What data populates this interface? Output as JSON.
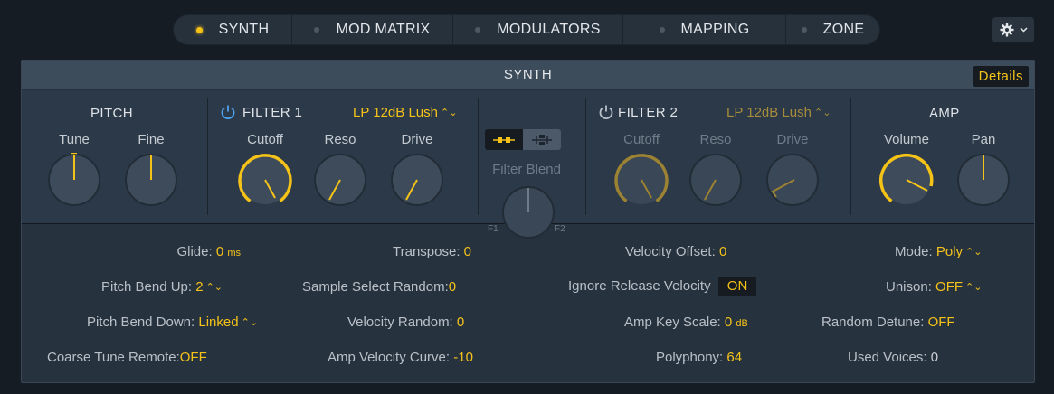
{
  "tabs": [
    {
      "label": "SYNTH",
      "active": true
    },
    {
      "label": "MOD MATRIX",
      "active": false
    },
    {
      "label": "MODULATORS",
      "active": false
    },
    {
      "label": "MAPPING",
      "active": false
    },
    {
      "label": "ZONE",
      "active": false
    }
  ],
  "gear_icon": "gear-icon",
  "accent_color": "#f5c318",
  "panel": {
    "title": "SYNTH",
    "details_label": "Details"
  },
  "pitch": {
    "title": "PITCH",
    "tune_label": "Tune",
    "fine_label": "Fine"
  },
  "filter1": {
    "title": "FILTER 1",
    "type": "LP 12dB Lush",
    "cutoff_label": "Cutoff",
    "reso_label": "Reso",
    "drive_label": "Drive",
    "enabled": true
  },
  "blend": {
    "label": "Filter Blend",
    "f1": "F1",
    "f2": "F2"
  },
  "filter2": {
    "title": "FILTER 2",
    "type": "LP 12dB Lush",
    "cutoff_label": "Cutoff",
    "reso_label": "Reso",
    "drive_label": "Drive",
    "enabled": false
  },
  "amp": {
    "title": "AMP",
    "volume_label": "Volume",
    "pan_label": "Pan"
  },
  "params": {
    "glide": {
      "label": "Glide:",
      "value": "0",
      "unit": "ms"
    },
    "pitch_bend_up": {
      "label": "Pitch Bend Up:",
      "value": "2"
    },
    "pitch_bend_down": {
      "label": "Pitch Bend Down:",
      "value": "Linked"
    },
    "coarse_tune_remote": {
      "label": "Coarse Tune Remote:",
      "value": "OFF"
    },
    "transpose": {
      "label": "Transpose:",
      "value": "0"
    },
    "sample_select_random": {
      "label": "Sample Select Random:",
      "value": "0"
    },
    "velocity_random": {
      "label": "Velocity Random:",
      "value": "0"
    },
    "amp_velocity_curve": {
      "label": "Amp Velocity Curve:",
      "value": "-10"
    },
    "velocity_offset": {
      "label": "Velocity Offset:",
      "value": "0"
    },
    "ignore_release_velocity": {
      "label": "Ignore Release Velocity",
      "value": "ON"
    },
    "amp_key_scale": {
      "label": "Amp Key Scale:",
      "value": "0",
      "unit": "dB"
    },
    "polyphony": {
      "label": "Polyphony:",
      "value": "64"
    },
    "mode": {
      "label": "Mode:",
      "value": "Poly"
    },
    "unison": {
      "label": "Unison:",
      "value": "OFF"
    },
    "random_detune": {
      "label": "Random Detune:",
      "value": "OFF"
    },
    "used_voices": {
      "label": "Used Voices:",
      "value": "0"
    }
  }
}
